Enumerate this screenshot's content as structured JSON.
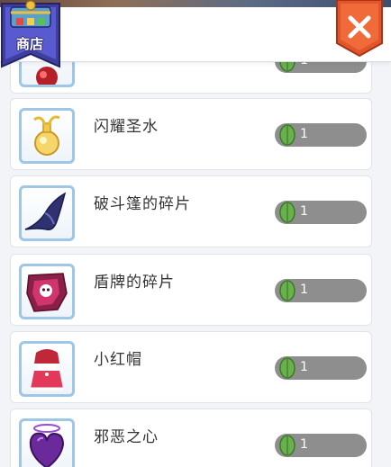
{
  "header": {
    "shop_label": "商店"
  },
  "items": [
    {
      "name": "",
      "icon": "red-orb-icon",
      "price": "1"
    },
    {
      "name": "闪耀圣水",
      "icon": "holy-water-icon",
      "price": "1"
    },
    {
      "name": "破斗篷的碎片",
      "icon": "cloak-fragment-icon",
      "price": "1"
    },
    {
      "name": "盾牌的碎片",
      "icon": "shield-fragment-icon",
      "price": "1"
    },
    {
      "name": "小红帽",
      "icon": "red-hood-icon",
      "price": "1"
    },
    {
      "name": "邪恶之心",
      "icon": "evil-heart-icon",
      "price": "1"
    }
  ],
  "colors": {
    "frame": "#9ec6e6",
    "pill": "#8e8e8e",
    "close": "#e0552a",
    "badge": "#3f3fa0"
  }
}
